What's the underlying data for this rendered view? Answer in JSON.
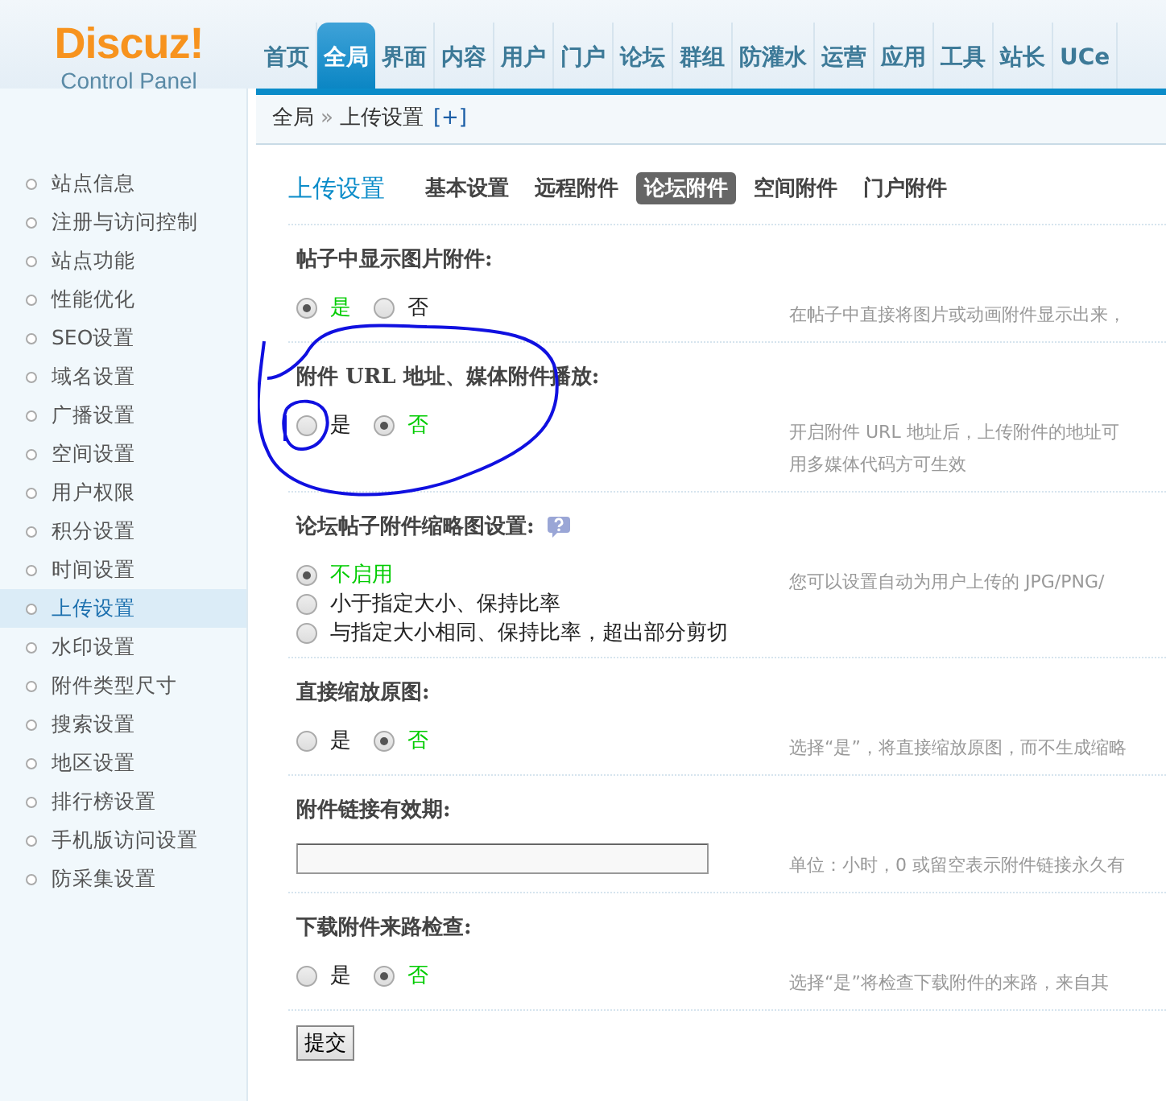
{
  "logo": {
    "title": "Discuz",
    "mark": "!",
    "subtitle": "Control Panel"
  },
  "nav": [
    {
      "label": "首页",
      "selected": false
    },
    {
      "label": "全局",
      "selected": true
    },
    {
      "label": "界面",
      "selected": false
    },
    {
      "label": "内容",
      "selected": false
    },
    {
      "label": "用户",
      "selected": false
    },
    {
      "label": "门户",
      "selected": false
    },
    {
      "label": "论坛",
      "selected": false
    },
    {
      "label": "群组",
      "selected": false
    },
    {
      "label": "防灌水",
      "selected": false
    },
    {
      "label": "运营",
      "selected": false
    },
    {
      "label": "应用",
      "selected": false
    },
    {
      "label": "工具",
      "selected": false
    },
    {
      "label": "站长",
      "selected": false
    },
    {
      "label": "UCe",
      "selected": false
    }
  ],
  "breadcrumb": {
    "items": [
      "全局",
      "上传设置"
    ],
    "separator": "»",
    "add": "[+]"
  },
  "sidebar": {
    "items": [
      {
        "label": "站点信息",
        "selected": false
      },
      {
        "label": "注册与访问控制",
        "selected": false
      },
      {
        "label": "站点功能",
        "selected": false
      },
      {
        "label": "性能优化",
        "selected": false
      },
      {
        "label": "SEO设置",
        "selected": false
      },
      {
        "label": "域名设置",
        "selected": false
      },
      {
        "label": "广播设置",
        "selected": false
      },
      {
        "label": "空间设置",
        "selected": false
      },
      {
        "label": "用户权限",
        "selected": false
      },
      {
        "label": "积分设置",
        "selected": false
      },
      {
        "label": "时间设置",
        "selected": false
      },
      {
        "label": "上传设置",
        "selected": true
      },
      {
        "label": "水印设置",
        "selected": false
      },
      {
        "label": "附件类型尺寸",
        "selected": false
      },
      {
        "label": "搜索设置",
        "selected": false
      },
      {
        "label": "地区设置",
        "selected": false
      },
      {
        "label": "排行榜设置",
        "selected": false
      },
      {
        "label": "手机版访问设置",
        "selected": false
      },
      {
        "label": "防采集设置",
        "selected": false
      }
    ]
  },
  "page_title": "上传设置",
  "subtabs": [
    {
      "label": "基本设置",
      "selected": false
    },
    {
      "label": "远程附件",
      "selected": false
    },
    {
      "label": "论坛附件",
      "selected": true
    },
    {
      "label": "空间附件",
      "selected": false
    },
    {
      "label": "门户附件",
      "selected": false
    }
  ],
  "settings": [
    {
      "label": "帖子中显示图片附件:",
      "kind": "radio-inline",
      "options": [
        {
          "label": "是",
          "selected": true
        },
        {
          "label": "否",
          "selected": false
        }
      ],
      "hint": [
        "在帖子中直接将图片或动画附件显示出来，"
      ]
    },
    {
      "label": "附件 URL 地址、媒体附件播放:",
      "kind": "radio-inline",
      "options": [
        {
          "label": "是",
          "selected": false
        },
        {
          "label": "否",
          "selected": true
        }
      ],
      "hint": [
        "开启附件 URL 地址后，上传附件的地址可",
        "用多媒体代码方可生效"
      ]
    },
    {
      "label": "论坛帖子附件缩略图设置:",
      "help": true,
      "kind": "radio-stack",
      "options": [
        {
          "label": "不启用",
          "selected": true
        },
        {
          "label": "小于指定大小、保持比率",
          "selected": false
        },
        {
          "label": "与指定大小相同、保持比率，超出部分剪切",
          "selected": false
        }
      ],
      "hint": [
        "您可以设置自动为用户上传的 JPG/PNG/"
      ]
    },
    {
      "label": "直接缩放原图:",
      "kind": "radio-inline",
      "options": [
        {
          "label": "是",
          "selected": false
        },
        {
          "label": "否",
          "selected": true
        }
      ],
      "hint": [
        "选择“是”，将直接缩放原图，而不生成缩略"
      ]
    },
    {
      "label": "附件链接有效期:",
      "kind": "text",
      "hint": [
        "单位：小时，0 或留空表示附件链接永久有"
      ]
    },
    {
      "label": "下载附件来路检查:",
      "kind": "radio-inline",
      "options": [
        {
          "label": "是",
          "selected": false
        },
        {
          "label": "否",
          "selected": true
        }
      ],
      "hint": [
        "选择“是”将检查下载附件的来路，来自其"
      ]
    }
  ],
  "submit": "提交"
}
